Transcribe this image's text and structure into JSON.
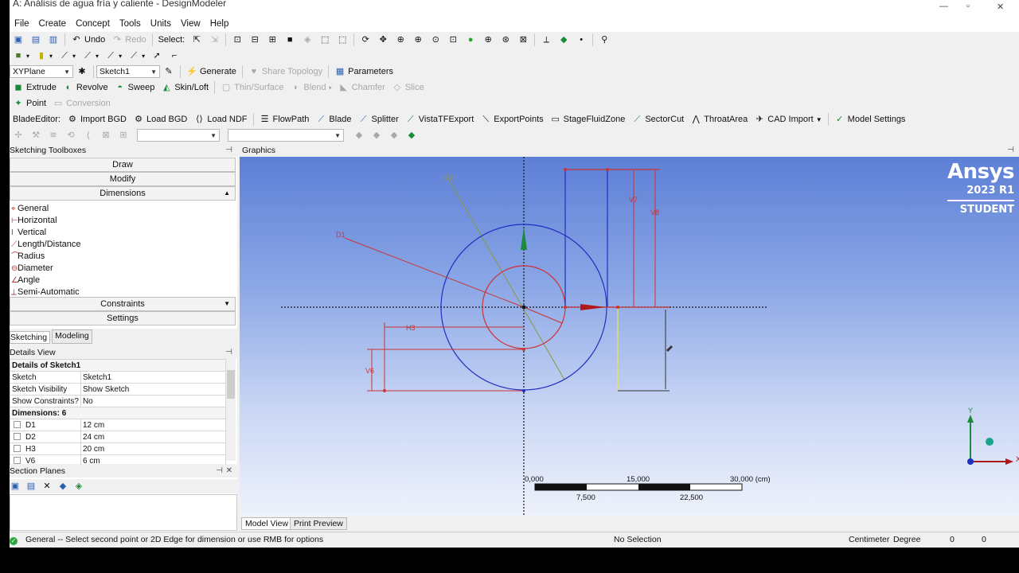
{
  "window": {
    "title": "A: Análisis de agua fría y caliente - DesignModeler"
  },
  "menu": [
    "File",
    "Create",
    "Concept",
    "Tools",
    "Units",
    "View",
    "Help"
  ],
  "toolbar1": {
    "undo": "Undo",
    "redo": "Redo",
    "select": "Select:"
  },
  "toolbar3": {
    "plane": "XYPlane",
    "sketch": "Sketch1",
    "generate": "Generate",
    "share_topology": "Share Topology",
    "parameters": "Parameters"
  },
  "toolbar4": [
    "Extrude",
    "Revolve",
    "Sweep",
    "Skin/Loft",
    "Thin/Surface",
    "Blend",
    "Chamfer",
    "Slice"
  ],
  "toolbar5": [
    "Point",
    "Conversion"
  ],
  "toolbar6": {
    "label": "BladeEditor:",
    "items": [
      "Import BGD",
      "Load BGD",
      "Load NDF",
      "FlowPath",
      "Blade",
      "Splitter",
      "VistaTFExport",
      "ExportPoints",
      "StageFluidZone",
      "SectorCut",
      "ThroatArea",
      "CAD Import",
      "Model Settings"
    ]
  },
  "toolboxes": {
    "header": "Sketching Toolboxes",
    "draw": "Draw",
    "modify": "Modify",
    "dimensions": "Dimensions",
    "tools": [
      "General",
      "Horizontal",
      "Vertical",
      "Length/Distance",
      "Radius",
      "Diameter",
      "Angle",
      "Semi-Automatic"
    ],
    "constraints": "Constraints",
    "settings": "Settings",
    "tab_sketching": "Sketching",
    "tab_modeling": "Modeling"
  },
  "details": {
    "header": "Details View",
    "title": "Details of Sketch1",
    "rows": [
      {
        "k": "Sketch",
        "v": "Sketch1"
      },
      {
        "k": "Sketch Visibility",
        "v": "Show Sketch"
      },
      {
        "k": "Show Constraints?",
        "v": "No"
      }
    ],
    "dims_title": "Dimensions: 6",
    "dims": [
      {
        "k": "D1",
        "v": "12 cm"
      },
      {
        "k": "D2",
        "v": "24 cm"
      },
      {
        "k": "H3",
        "v": "20 cm"
      },
      {
        "k": "V6",
        "v": "6 cm"
      }
    ]
  },
  "section_planes": {
    "header": "Section Planes"
  },
  "graphics": {
    "header": "Graphics",
    "logo": "Ansys",
    "version": "2023 R1",
    "edition": "STUDENT",
    "labels": [
      "D1",
      "H3",
      "V6",
      "V7",
      "V8",
      "D2"
    ],
    "scale": {
      "top": [
        "0,000",
        "15,000",
        "30,000 (cm)"
      ],
      "bottom": [
        "7,500",
        "22,500"
      ]
    },
    "axes": {
      "x": "X",
      "y": "Y"
    }
  },
  "view_tabs": [
    "Model View",
    "Print Preview"
  ],
  "status": {
    "message": "General -- Select second point or 2D Edge for dimension or use RMB for options",
    "selection": "No Selection",
    "unit_length": "Centimeter",
    "unit_angle": "Degree",
    "v1": "0",
    "v2": "0"
  }
}
